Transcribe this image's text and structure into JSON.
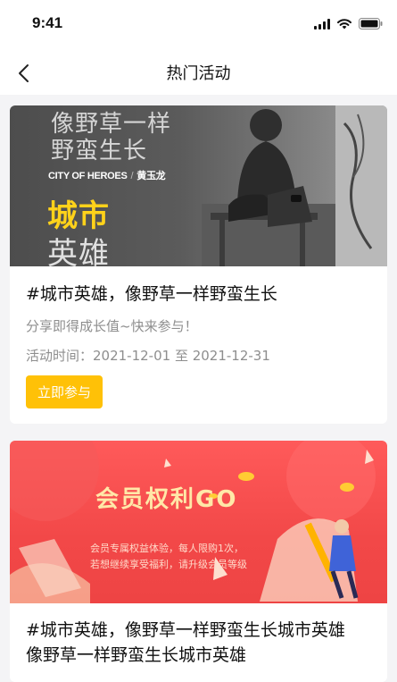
{
  "status_bar": {
    "time": "9:41"
  },
  "nav": {
    "title": "热门活动"
  },
  "activities": [
    {
      "banner": {
        "slogan_line1": "像野草一样",
        "slogan_line2": "野蛮生长",
        "english": "CITY OF HEROES",
        "separator": "/",
        "author": "黄玉龙",
        "big_line1": "城市",
        "big_line2": "英雄"
      },
      "title": "#城市英雄，像野草一样野蛮生长",
      "description": "分享即得成长值~快来参与！",
      "time": "活动时间：2021-12-01 至 2021-12-31",
      "button": "立即参与"
    },
    {
      "banner": {
        "title": "会员权利GO",
        "line1": "会员专属权益体验，每人限购1次，",
        "line2": "若想继续享受福利，请升级会员等级"
      },
      "title_line1": "#城市英雄，像野草一样野蛮生长城市英雄",
      "title_line2": "像野草一样野蛮生长城市英雄"
    }
  ],
  "colors": {
    "accent_yellow": "#ffc107",
    "banner_red": "#f24848",
    "muted_text": "#8e8e8e"
  },
  "icons": [
    "signal-icon",
    "wifi-icon",
    "battery-icon",
    "back-chevron-icon"
  ]
}
